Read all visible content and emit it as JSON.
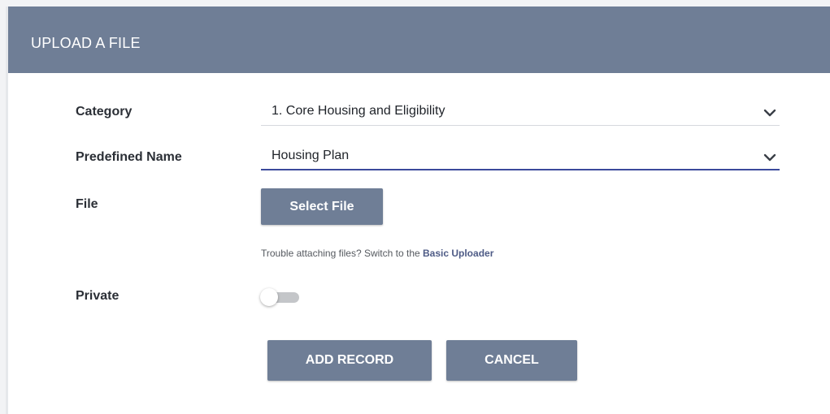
{
  "dialog": {
    "title": "UPLOAD A FILE"
  },
  "form": {
    "category": {
      "label": "Category",
      "value": "1. Core Housing and Eligibility",
      "icon": "chevron-down-icon"
    },
    "predefined_name": {
      "label": "Predefined Name",
      "value": "Housing Plan",
      "icon": "chevron-down-icon"
    },
    "file": {
      "label": "File",
      "button_label": "Select File"
    },
    "help": {
      "text": "Trouble attaching files? Switch to the ",
      "link": "Basic Uploader"
    },
    "private": {
      "label": "Private",
      "enabled": false
    }
  },
  "actions": {
    "add_label": "ADD RECORD",
    "cancel_label": "CANCEL"
  },
  "colors": {
    "header": "#6f7e96",
    "button": "#6f7e96",
    "focus_underline": "#3b4a9c",
    "link": "#4e5b86"
  }
}
